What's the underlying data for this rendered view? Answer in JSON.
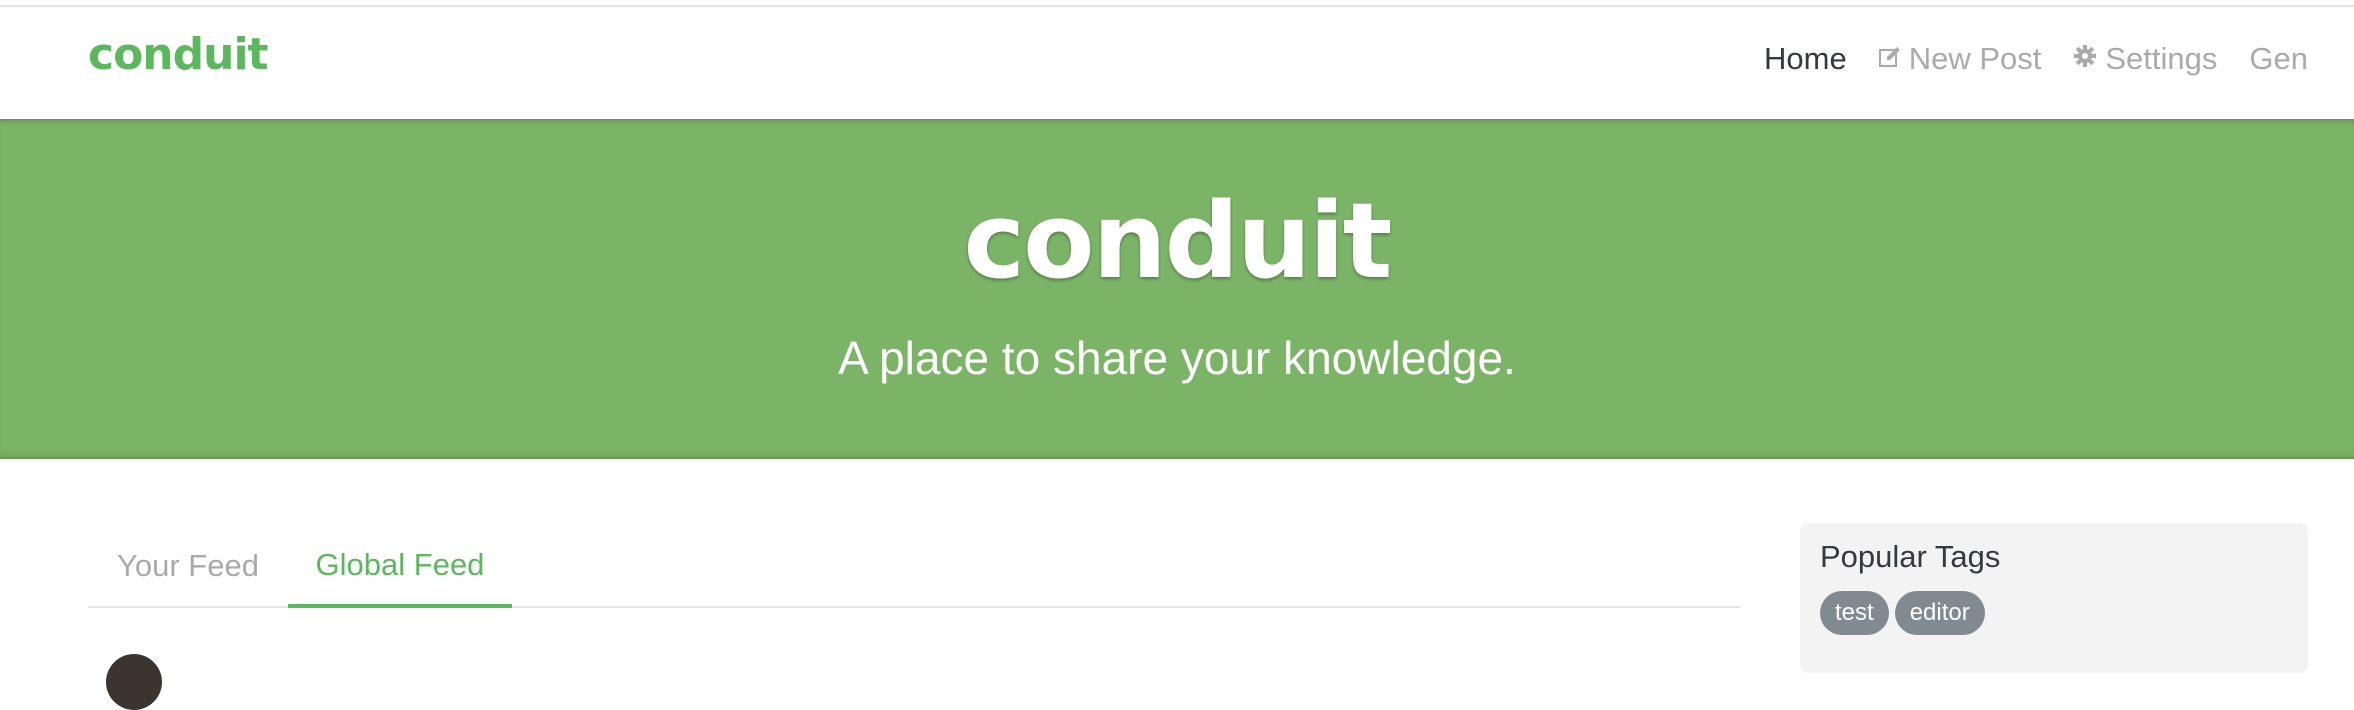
{
  "navbar": {
    "brand": "conduit",
    "links": [
      {
        "label": "Home",
        "icon": null,
        "active": true
      },
      {
        "label": "New Post",
        "icon": "edit-icon",
        "active": false
      },
      {
        "label": "Settings",
        "icon": "gear-icon",
        "active": false
      },
      {
        "label": "Gen",
        "icon": null,
        "active": false
      }
    ]
  },
  "banner": {
    "title": "conduit",
    "subtitle": "A place to share your knowledge."
  },
  "feed": {
    "tabs": [
      {
        "label": "Your Feed",
        "active": false
      },
      {
        "label": "Global Feed",
        "active": true
      }
    ]
  },
  "sidebar": {
    "title": "Popular Tags",
    "tags": [
      "test",
      "editor"
    ]
  },
  "colors": {
    "brand": "#5cb85c",
    "banner": "#7bb467",
    "tag": "#818a91",
    "nav_inactive": "#aaaaaa",
    "nav_active": "#373a3c"
  }
}
